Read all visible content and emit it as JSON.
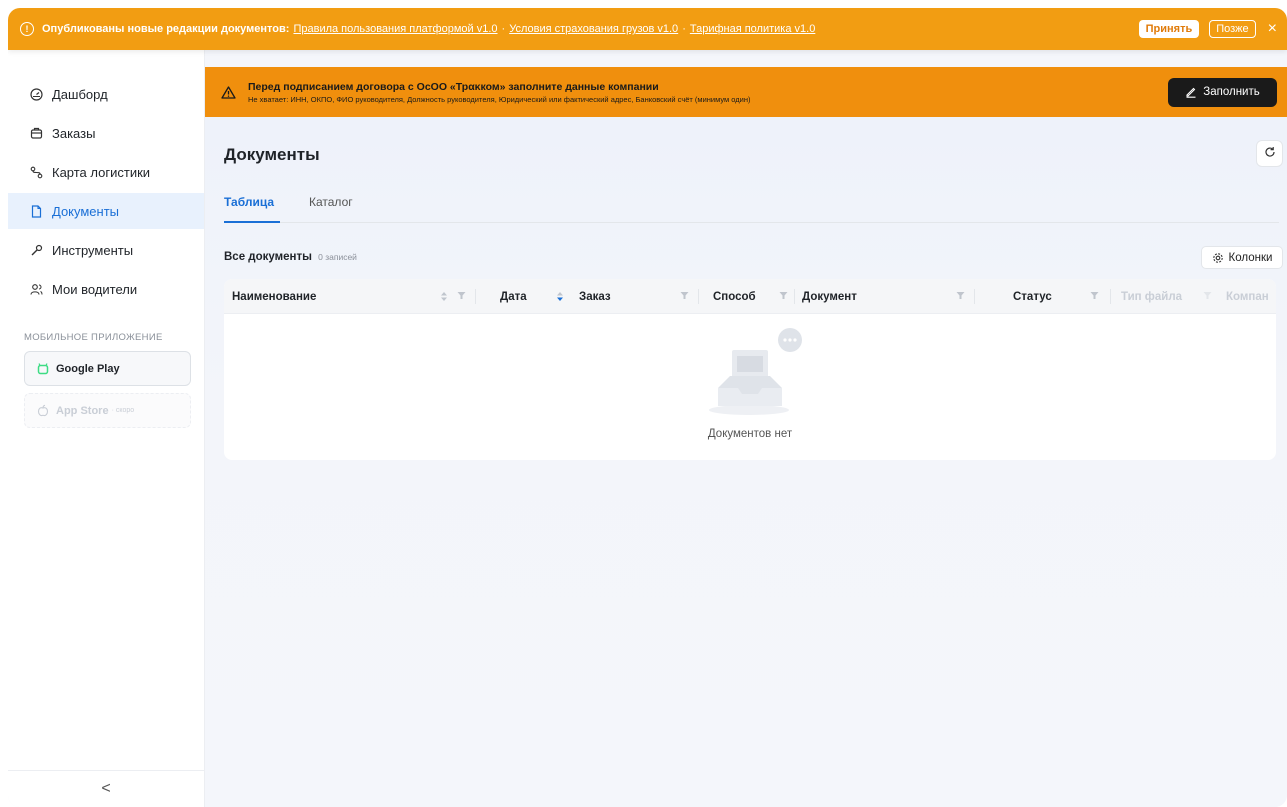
{
  "notification": {
    "lead": "Опубликованы новые редакции документов:",
    "links": [
      "Правила пользования платформой v1.0",
      "Условия страхования грузов v1.0",
      "Тарифная политика v1.0"
    ],
    "separator": "·",
    "accept": "Принять",
    "later": "Позже",
    "close": "×"
  },
  "sidebar": {
    "items": [
      {
        "label": "Дашборд",
        "icon": "dashboard-icon"
      },
      {
        "label": "Заказы",
        "icon": "orders-icon"
      },
      {
        "label": "Карта логистики",
        "icon": "route-icon"
      },
      {
        "label": "Документы",
        "icon": "document-icon",
        "active": true
      },
      {
        "label": "Инструменты",
        "icon": "wrench-icon"
      },
      {
        "label": "Мои водители",
        "icon": "users-icon"
      }
    ],
    "section_label": "МОБИЛЬНОЕ ПРИЛОЖЕНИЕ",
    "google_play": "Google Play",
    "app_store": "App Store",
    "app_store_soon": "· скоро",
    "collapse": "<"
  },
  "warning": {
    "title": "Перед подписанием договора с ОсОО «Трακком» заполните данные компании",
    "details": "Не хватает: ИНН, ОКПО, ФИО руководителя, Должность руководителя, Юридический или фактический адрес, Банковский счёт (минимум один)",
    "button": "Заполнить"
  },
  "main": {
    "title": "Документы",
    "tabs": [
      "Таблица",
      "Каталог"
    ],
    "active_tab": "Таблица",
    "subtitle": "Все документы",
    "count": "0 записей",
    "columns_button": "Колонки",
    "columns": [
      "Наименование",
      "Дата",
      "Заказ",
      "Способ",
      "Документ",
      "Статус",
      "Тип файла",
      "Компан"
    ],
    "empty_text": "Документов нет"
  },
  "colors": {
    "accent": "#1a6fd6",
    "notification_bg": "#f29d12",
    "warning_bg": "#f08f0d"
  }
}
